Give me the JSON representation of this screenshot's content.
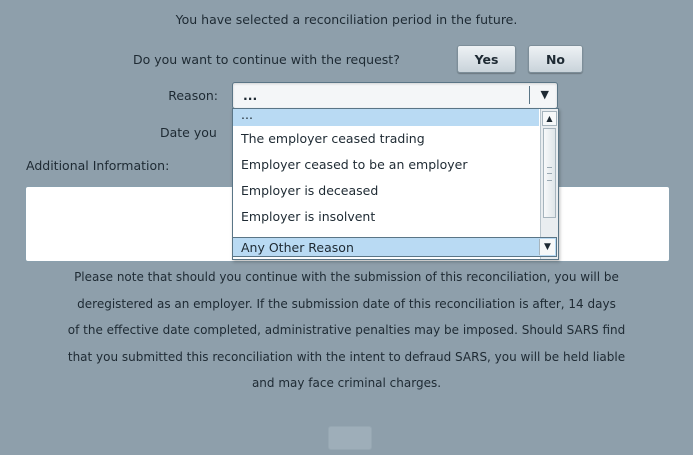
{
  "dialog": {
    "message_future": "You have selected a reconciliation period in the future.",
    "question": "Do you want to continue with the request?",
    "yes_label": "Yes",
    "no_label": "No",
    "reason_label": "Reason:",
    "reason_value": "...",
    "date_label": "Date you",
    "additional_info_label": "Additional Information:",
    "additional_info_value": "",
    "notice_lines": [
      "Please note that should you continue with the submission of this reconciliation, you will be",
      "deregistered as an employer. If the submission date of this reconciliation is after, 14 days",
      "of the effective date completed, administrative penalties may be imposed. Should SARS find",
      "that you submitted this reconciliation with the intent to defraud SARS, you will be held liable",
      "and may face criminal charges."
    ]
  },
  "dropdown": {
    "options": [
      "...",
      "The employer ceased trading",
      "Employer ceased to be an employer",
      "Employer is deceased",
      "Employer is insolvent"
    ],
    "hovered_option": "Any Other Reason"
  },
  "icons": {
    "dropdown_arrow": "caret-down-icon",
    "scroll_up": "scroll-up-icon",
    "scroll_down": "scroll-down-icon"
  },
  "colors": {
    "background": "#8e9fab",
    "selection": "#b9daf3"
  }
}
